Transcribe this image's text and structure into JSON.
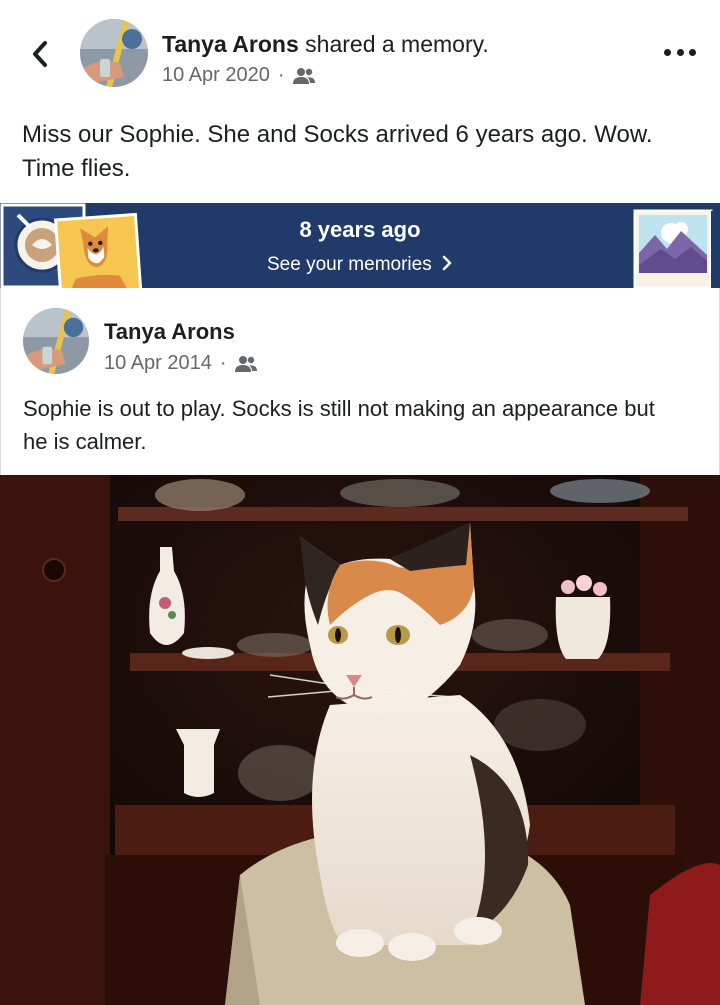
{
  "header": {
    "author": "Tanya Arons",
    "action": "shared a memory.",
    "date": "10 Apr 2020",
    "separator": "·",
    "audience_icon": "friends-icon"
  },
  "post": {
    "text": "Miss our Sophie.  She and Socks arrived 6 years ago.  Wow.  Time flies."
  },
  "banner": {
    "title": "8 years ago",
    "subtitle": "See your memories",
    "chevron": "›",
    "colors": {
      "background": "#203b69",
      "text": "#ffffff"
    }
  },
  "shared_post": {
    "author": "Tanya Arons",
    "date": "10 Apr 2014",
    "separator": "·",
    "audience_icon": "friends-icon",
    "text": "Sophie is out to play.  Socks is still not making an appearance but he is calmer."
  },
  "photo": {
    "subject": "calico-cat-photo"
  },
  "icons": {
    "back": "chevron-left-icon",
    "more": "more-options-icon"
  }
}
